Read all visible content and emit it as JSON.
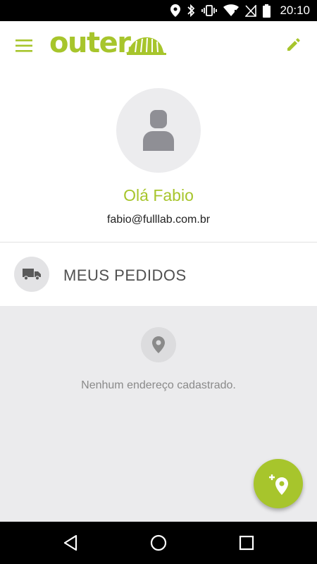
{
  "status_bar": {
    "time": "20:10",
    "icons": [
      "location-icon",
      "bluetooth-icon",
      "vibrate-icon",
      "wifi-icon",
      "no-signal-icon",
      "battery-icon"
    ]
  },
  "app_bar": {
    "logo_text": "outer.",
    "menu_icon": "hamburger-menu-icon",
    "edit_icon": "pencil-icon"
  },
  "profile": {
    "greeting": "Olá Fabio",
    "email": "fabio@fulllab.com.br"
  },
  "orders": {
    "label": "MEUS PEDIDOS",
    "icon": "truck-icon"
  },
  "addresses": {
    "empty_message": "Nenhum endereço cadastrado.",
    "icon": "location-pin-icon"
  },
  "fab": {
    "icon": "add-location-icon"
  },
  "nav_bar": {
    "buttons": [
      "back",
      "home",
      "recents"
    ]
  },
  "colors": {
    "accent": "#a7c52c",
    "background_gray": "#ebebed",
    "text_dark": "#505050"
  }
}
